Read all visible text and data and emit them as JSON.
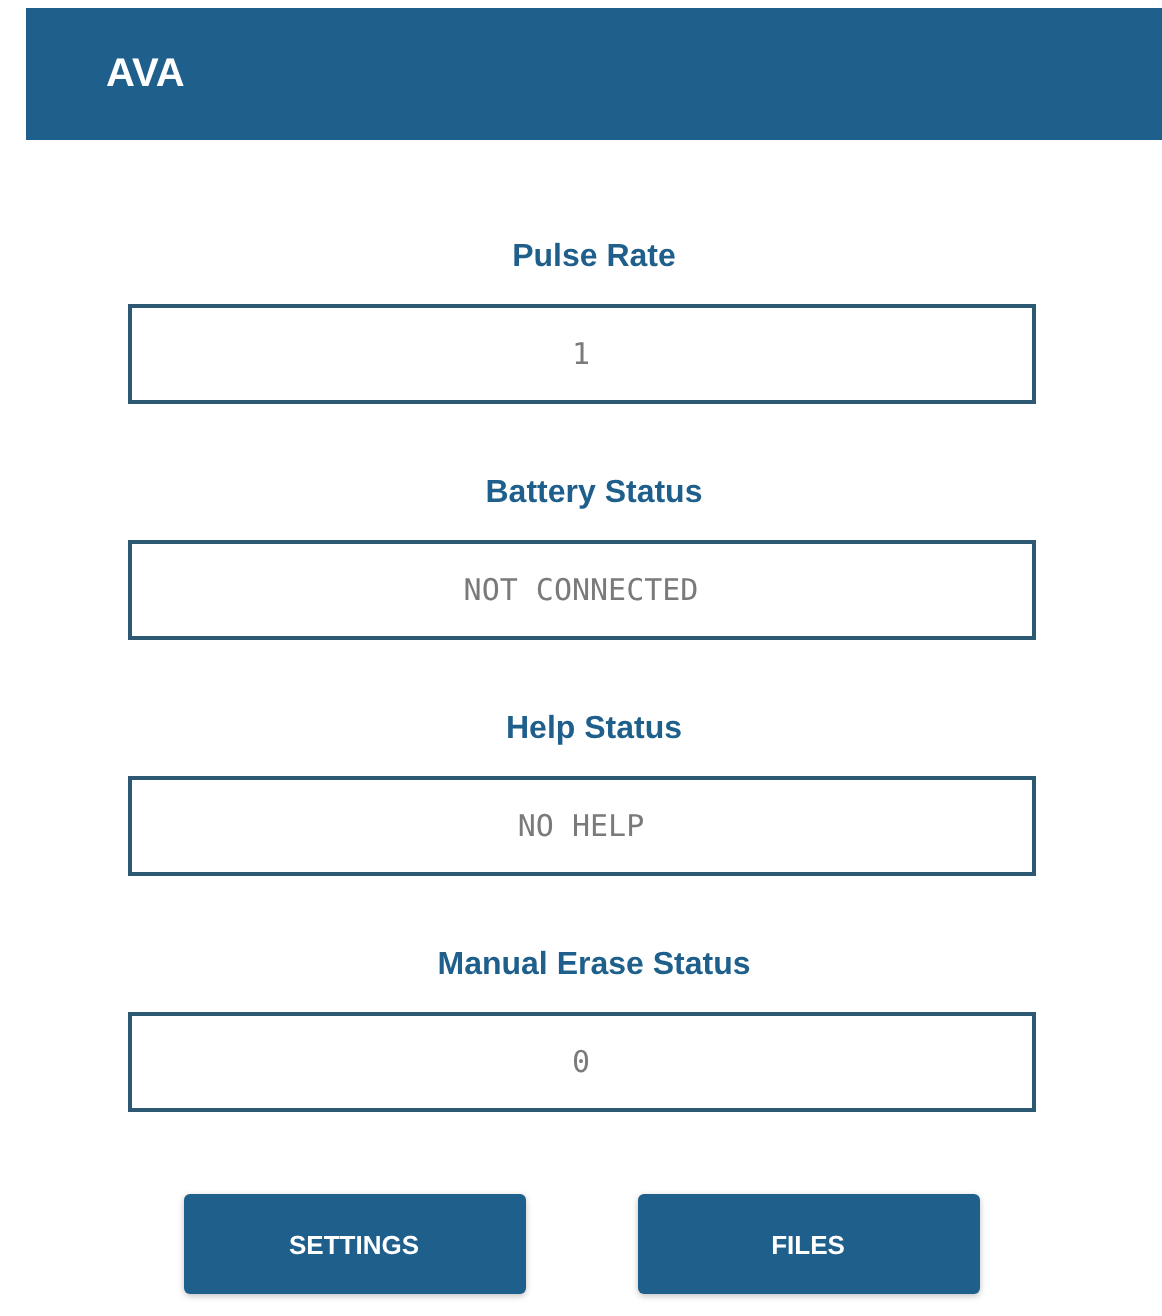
{
  "app_bar": {
    "title": "AVA"
  },
  "fields": [
    {
      "label": "Pulse Rate",
      "value": "1"
    },
    {
      "label": "Battery Status",
      "value": "NOT CONNECTED"
    },
    {
      "label": "Help Status",
      "value": "NO HELP"
    },
    {
      "label": "Manual Erase Status",
      "value": "0"
    }
  ],
  "buttons": [
    "SETTINGS",
    "FILES"
  ]
}
